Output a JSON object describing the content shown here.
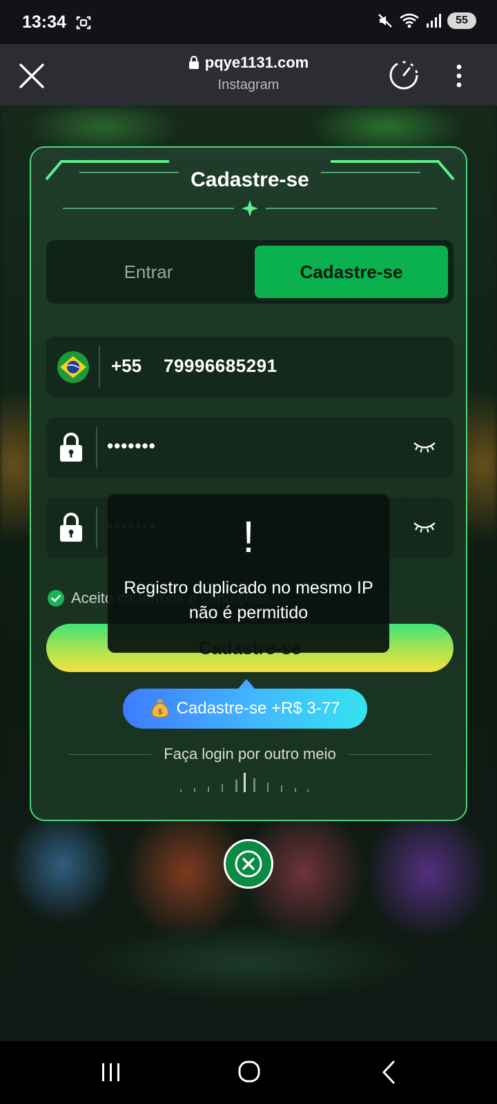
{
  "status_bar": {
    "time": "13:34",
    "battery": "55"
  },
  "browser": {
    "url": "pqye1131.com",
    "subtitle": "Instagram"
  },
  "modal": {
    "title": "Cadastre-se",
    "tabs": {
      "login": "Entrar",
      "register": "Cadastre-se"
    },
    "phone": {
      "country_code": "+55",
      "number": "79996685291"
    },
    "password": "•••••••",
    "confirm_password": "•••••••",
    "terms_label": "Aceito os termos e condições",
    "submit_label": "Cadastre-se",
    "bonus_label": "Cadastre-se +R$ 3-77",
    "alt_login": "Faça login por outro meio"
  },
  "toast": {
    "icon": "!",
    "message": "Registro duplicado no mesmo IP não é permitido"
  },
  "colors": {
    "accent": "#0bb14e",
    "modal_border": "#4ed67a",
    "bonus_start": "#3e7bff",
    "bonus_end": "#34e3ee"
  }
}
